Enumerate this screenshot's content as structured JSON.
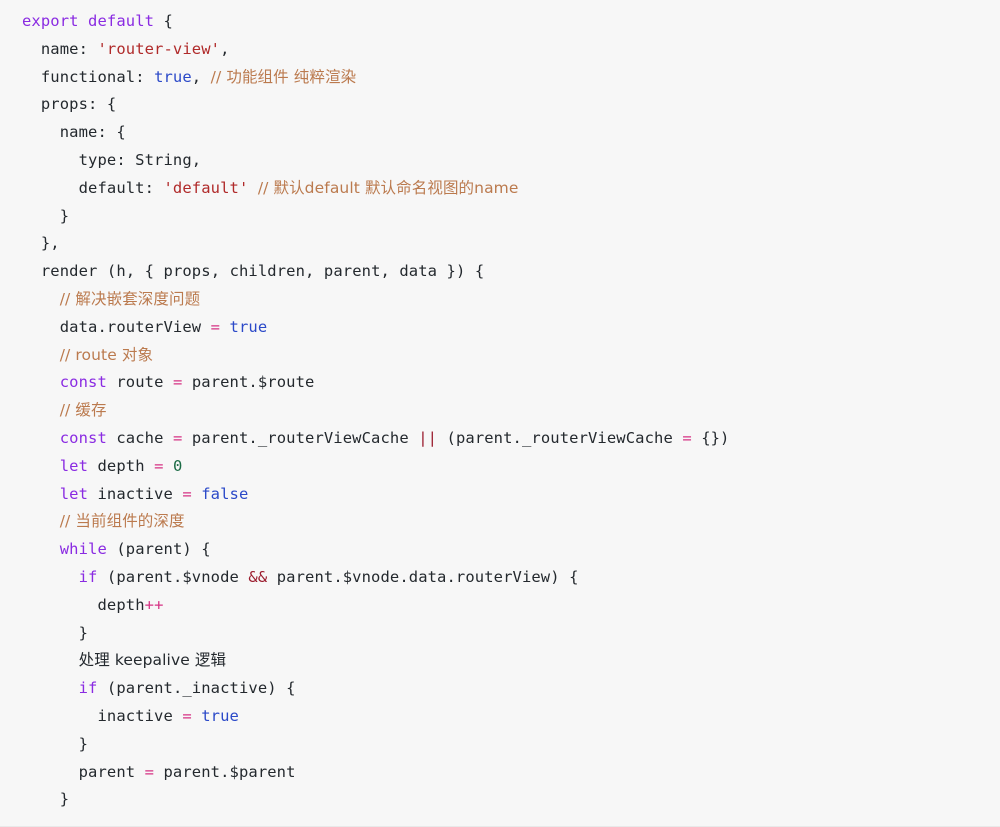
{
  "editor": {
    "language": "javascript",
    "background_color": "#f7f7f7",
    "theme_colors": {
      "plain": "#24292e",
      "keyword": "#8a2be2",
      "identifier": "#2b49c8",
      "string": "#b02a2a",
      "comment": "#bb7a4e",
      "operator": "#d63384",
      "logical": "#9b1c2e",
      "number": "#1b6b45"
    }
  },
  "code": {
    "lines": [
      {
        "indent": 0,
        "tokens": [
          {
            "t": "export",
            "c": "keyword"
          },
          {
            "t": " ",
            "c": "plain"
          },
          {
            "t": "default",
            "c": "keyword"
          },
          {
            "t": " {",
            "c": "plain"
          }
        ]
      },
      {
        "indent": 1,
        "tokens": [
          {
            "t": "name: ",
            "c": "plain"
          },
          {
            "t": "'router-view'",
            "c": "string"
          },
          {
            "t": ",",
            "c": "plain"
          }
        ]
      },
      {
        "indent": 1,
        "tokens": [
          {
            "t": "functional: ",
            "c": "plain"
          },
          {
            "t": "true",
            "c": "bool"
          },
          {
            "t": ", ",
            "c": "plain"
          },
          {
            "t": "// 功能组件 纯粹渲染",
            "c": "comment"
          }
        ]
      },
      {
        "indent": 1,
        "tokens": [
          {
            "t": "props: {",
            "c": "plain"
          }
        ]
      },
      {
        "indent": 2,
        "tokens": [
          {
            "t": "name: {",
            "c": "plain"
          }
        ]
      },
      {
        "indent": 3,
        "tokens": [
          {
            "t": "type: String,",
            "c": "plain"
          }
        ]
      },
      {
        "indent": 3,
        "tokens": [
          {
            "t": "default: ",
            "c": "plain"
          },
          {
            "t": "'default'",
            "c": "string"
          },
          {
            "t": " ",
            "c": "plain"
          },
          {
            "t": "// 默认default 默认命名视图的name",
            "c": "comment"
          }
        ]
      },
      {
        "indent": 2,
        "tokens": [
          {
            "t": "}",
            "c": "plain"
          }
        ]
      },
      {
        "indent": 1,
        "tokens": [
          {
            "t": "},",
            "c": "plain"
          }
        ]
      },
      {
        "indent": 1,
        "tokens": [
          {
            "t": "render ",
            "c": "plain"
          },
          {
            "t": "(",
            "c": "plain"
          },
          {
            "t": "h",
            "c": "identifier"
          },
          {
            "t": ", { ",
            "c": "plain"
          },
          {
            "t": "props",
            "c": "identifier"
          },
          {
            "t": ", ",
            "c": "plain"
          },
          {
            "t": "children",
            "c": "identifier"
          },
          {
            "t": ", ",
            "c": "plain"
          },
          {
            "t": "parent",
            "c": "identifier"
          },
          {
            "t": ", ",
            "c": "plain"
          },
          {
            "t": "data",
            "c": "identifier"
          },
          {
            "t": " }) {",
            "c": "plain"
          }
        ]
      },
      {
        "indent": 2,
        "tokens": [
          {
            "t": "// 解决嵌套深度问题",
            "c": "comment"
          }
        ]
      },
      {
        "indent": 2,
        "tokens": [
          {
            "t": "data",
            "c": "identifier"
          },
          {
            "t": ".routerView ",
            "c": "plain"
          },
          {
            "t": "=",
            "c": "operator"
          },
          {
            "t": " ",
            "c": "plain"
          },
          {
            "t": "true",
            "c": "bool"
          }
        ]
      },
      {
        "indent": 2,
        "tokens": [
          {
            "t": "// route 对象",
            "c": "comment"
          }
        ]
      },
      {
        "indent": 2,
        "tokens": [
          {
            "t": "const",
            "c": "keyword"
          },
          {
            "t": " ",
            "c": "plain"
          },
          {
            "t": "route",
            "c": "identifier"
          },
          {
            "t": " ",
            "c": "plain"
          },
          {
            "t": "=",
            "c": "operator"
          },
          {
            "t": " ",
            "c": "plain"
          },
          {
            "t": "parent",
            "c": "identifier"
          },
          {
            "t": ".$route",
            "c": "plain"
          }
        ]
      },
      {
        "indent": 2,
        "tokens": [
          {
            "t": "// 缓存",
            "c": "comment"
          }
        ]
      },
      {
        "indent": 2,
        "tokens": [
          {
            "t": "const",
            "c": "keyword"
          },
          {
            "t": " ",
            "c": "plain"
          },
          {
            "t": "cache",
            "c": "identifier"
          },
          {
            "t": " ",
            "c": "plain"
          },
          {
            "t": "=",
            "c": "operator"
          },
          {
            "t": " ",
            "c": "plain"
          },
          {
            "t": "parent",
            "c": "identifier"
          },
          {
            "t": "._routerViewCache ",
            "c": "plain"
          },
          {
            "t": "||",
            "c": "logical"
          },
          {
            "t": " (",
            "c": "plain"
          },
          {
            "t": "parent",
            "c": "identifier"
          },
          {
            "t": "._routerViewCache ",
            "c": "plain"
          },
          {
            "t": "=",
            "c": "operator"
          },
          {
            "t": " {})",
            "c": "plain"
          }
        ]
      },
      {
        "indent": 2,
        "tokens": [
          {
            "t": "let",
            "c": "keyword"
          },
          {
            "t": " ",
            "c": "plain"
          },
          {
            "t": "depth",
            "c": "identifier"
          },
          {
            "t": " ",
            "c": "plain"
          },
          {
            "t": "=",
            "c": "operator"
          },
          {
            "t": " ",
            "c": "plain"
          },
          {
            "t": "0",
            "c": "number"
          }
        ]
      },
      {
        "indent": 2,
        "tokens": [
          {
            "t": "let",
            "c": "keyword"
          },
          {
            "t": " ",
            "c": "plain"
          },
          {
            "t": "inactive",
            "c": "identifier"
          },
          {
            "t": " ",
            "c": "plain"
          },
          {
            "t": "=",
            "c": "operator"
          },
          {
            "t": " ",
            "c": "plain"
          },
          {
            "t": "false",
            "c": "bool"
          }
        ]
      },
      {
        "indent": 2,
        "tokens": [
          {
            "t": "// 当前组件的深度",
            "c": "comment"
          }
        ]
      },
      {
        "indent": 2,
        "tokens": [
          {
            "t": "while",
            "c": "keyword"
          },
          {
            "t": " (",
            "c": "plain"
          },
          {
            "t": "parent",
            "c": "identifier"
          },
          {
            "t": ") {",
            "c": "plain"
          }
        ]
      },
      {
        "indent": 3,
        "tokens": [
          {
            "t": "if",
            "c": "keyword"
          },
          {
            "t": " (",
            "c": "plain"
          },
          {
            "t": "parent",
            "c": "identifier"
          },
          {
            "t": ".$vnode ",
            "c": "plain"
          },
          {
            "t": "&&",
            "c": "logical"
          },
          {
            "t": " ",
            "c": "plain"
          },
          {
            "t": "parent",
            "c": "identifier"
          },
          {
            "t": ".$vnode.data.routerView) {",
            "c": "plain"
          }
        ]
      },
      {
        "indent": 4,
        "tokens": [
          {
            "t": "depth",
            "c": "identifier"
          },
          {
            "t": "++",
            "c": "operator"
          }
        ]
      },
      {
        "indent": 3,
        "tokens": [
          {
            "t": "}",
            "c": "plain"
          }
        ]
      },
      {
        "indent": 3,
        "tokens": [
          {
            "t": "处理 keepalive 逻辑",
            "c": "plain"
          }
        ]
      },
      {
        "indent": 3,
        "tokens": [
          {
            "t": "if",
            "c": "keyword"
          },
          {
            "t": " (",
            "c": "plain"
          },
          {
            "t": "parent",
            "c": "identifier"
          },
          {
            "t": "._inactive) {",
            "c": "plain"
          }
        ]
      },
      {
        "indent": 4,
        "tokens": [
          {
            "t": "inactive",
            "c": "identifier"
          },
          {
            "t": " ",
            "c": "plain"
          },
          {
            "t": "=",
            "c": "operator"
          },
          {
            "t": " ",
            "c": "plain"
          },
          {
            "t": "true",
            "c": "bool"
          }
        ]
      },
      {
        "indent": 3,
        "tokens": [
          {
            "t": "}",
            "c": "plain"
          }
        ]
      },
      {
        "indent": 3,
        "tokens": [
          {
            "t": "parent",
            "c": "identifier"
          },
          {
            "t": " ",
            "c": "plain"
          },
          {
            "t": "=",
            "c": "operator"
          },
          {
            "t": " ",
            "c": "plain"
          },
          {
            "t": "parent",
            "c": "identifier"
          },
          {
            "t": ".$parent",
            "c": "plain"
          }
        ]
      },
      {
        "indent": 2,
        "tokens": [
          {
            "t": "}",
            "c": "plain"
          }
        ]
      }
    ]
  }
}
